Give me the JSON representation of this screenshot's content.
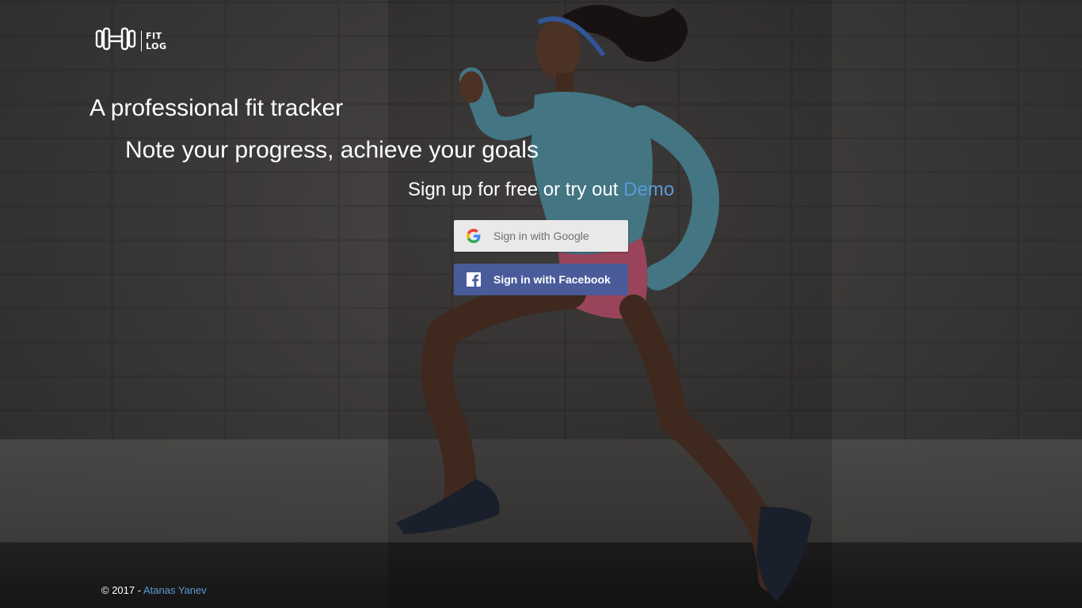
{
  "logo": {
    "text_line1": "FIT",
    "text_line2": "LOG",
    "icon": "dumbbell-icon"
  },
  "hero": {
    "tagline": "A professional fit tracker",
    "subtagline": "Note your progress, achieve your goals",
    "cta_prefix": "Sign up for free or try out",
    "demo_link": "Demo"
  },
  "auth": {
    "google_label": "Sign in with Google",
    "google_icon": "google-icon",
    "facebook_label": "Sign in with Facebook",
    "facebook_icon": "facebook-icon"
  },
  "footer": {
    "copyright": "© 2017 -",
    "author": "Atanas Yanev"
  },
  "colors": {
    "link": "#5b9bd9",
    "facebook": "#4a5b9a",
    "google_button": "#e9e9e9",
    "overlay": "#2b2929"
  }
}
